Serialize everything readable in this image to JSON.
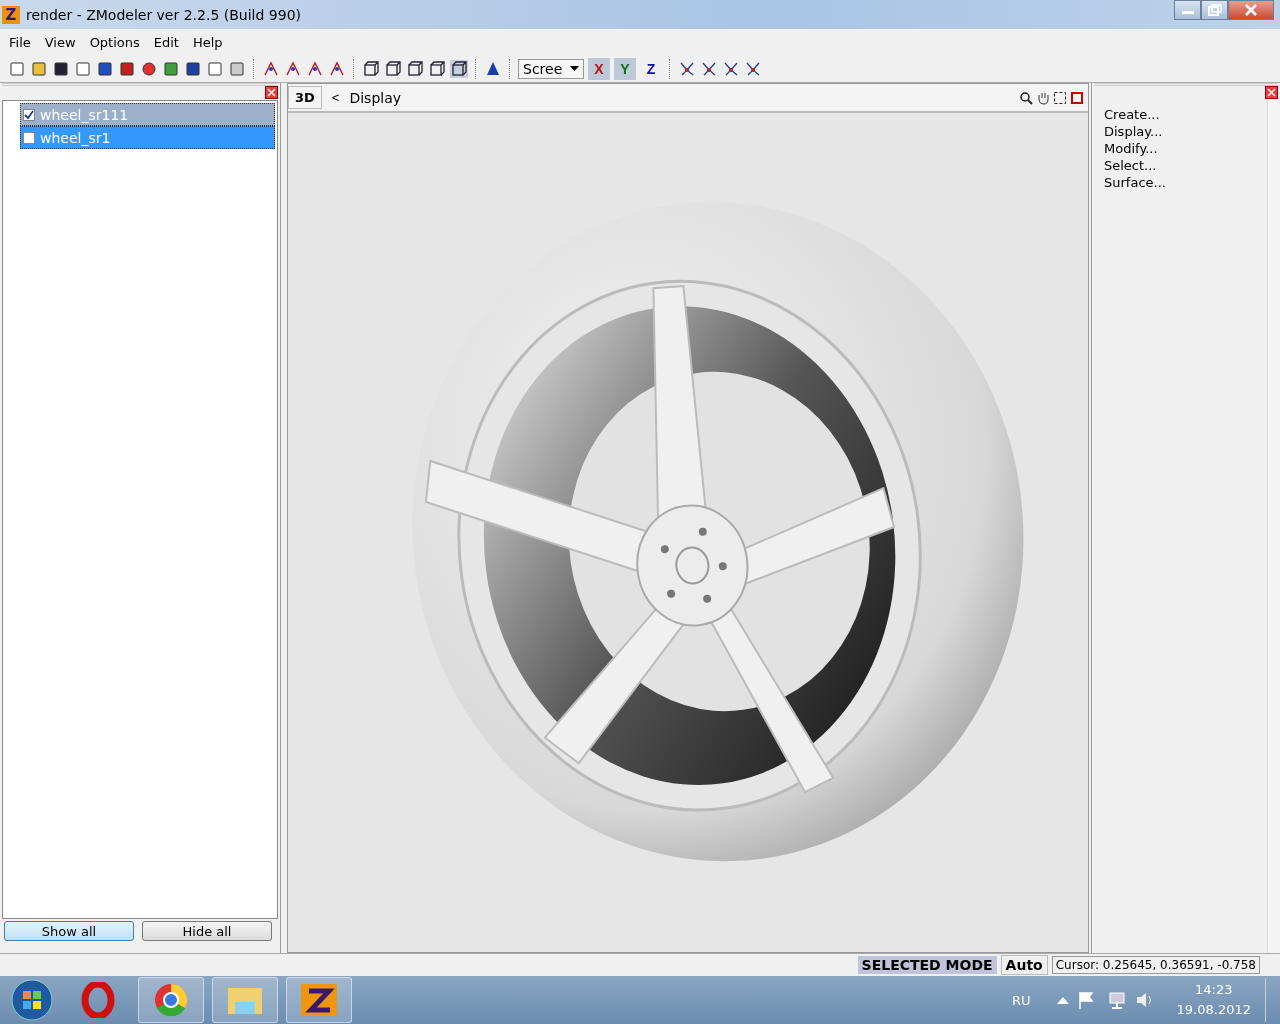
{
  "window": {
    "logo": "Z",
    "title": "render - ZModeler ver 2.2.5 (Build 990)"
  },
  "menu": [
    "File",
    "View",
    "Options",
    "Edit",
    "Help"
  ],
  "toolbar": {
    "view_dropdown": "Scree",
    "axes": [
      {
        "label": "X",
        "selected": true
      },
      {
        "label": "Y",
        "selected": true
      },
      {
        "label": "Z",
        "selected": false
      }
    ]
  },
  "objects": [
    {
      "name": "wheel_sr111",
      "checked": true,
      "focused": false
    },
    {
      "name": "wheel_sr1",
      "checked": false,
      "focused": true
    }
  ],
  "object_buttons": [
    {
      "label": "Show all",
      "default": true
    },
    {
      "label": "Hide all",
      "default": false
    }
  ],
  "viewport": {
    "view_label": "3D",
    "back": "<",
    "breadcrumb": "Display"
  },
  "commands": [
    "Create...",
    "Display...",
    "Modify...",
    "Select...",
    "Surface..."
  ],
  "status_bar": {
    "mode": "SELECTED MODE",
    "snap": "Auto",
    "cursor": "Cursor: 0.25645, 0.36591, -0.758"
  },
  "taskbar": {
    "language": "RU",
    "time": "14:23",
    "date": "19.08.2012"
  }
}
